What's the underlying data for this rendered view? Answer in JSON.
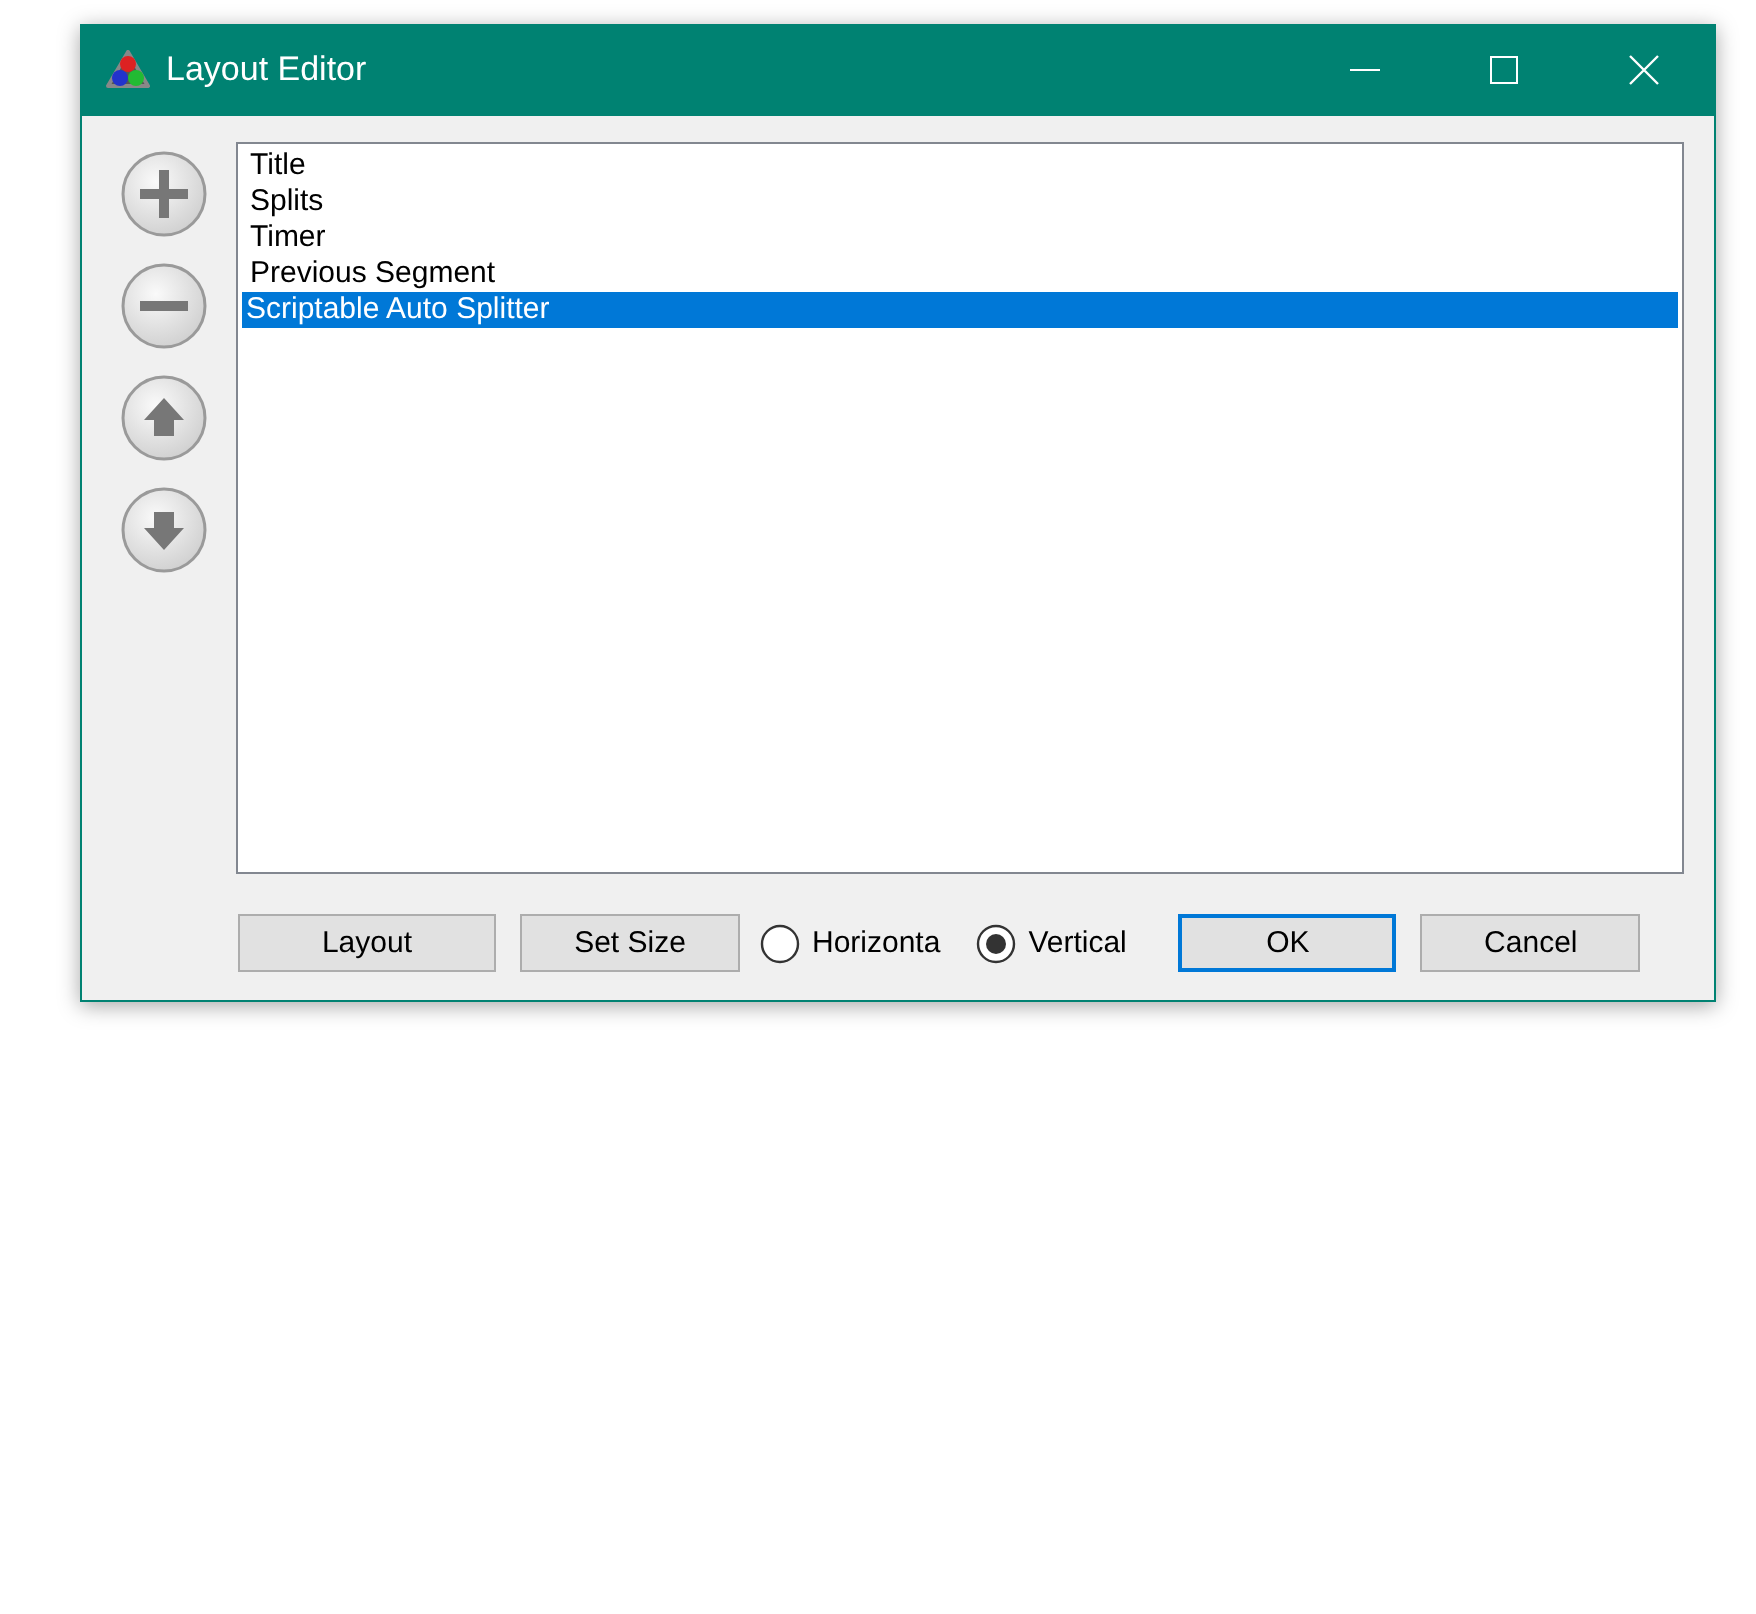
{
  "window": {
    "title": "Layout Editor"
  },
  "tools": [
    {
      "kind": "add"
    },
    {
      "kind": "remove"
    },
    {
      "kind": "up"
    },
    {
      "kind": "down"
    }
  ],
  "components": [
    {
      "label": "Title",
      "selected": false
    },
    {
      "label": "Splits",
      "selected": false
    },
    {
      "label": "Timer",
      "selected": false
    },
    {
      "label": "Previous Segment",
      "selected": false
    },
    {
      "label": "Scriptable Auto Splitter",
      "selected": true
    }
  ],
  "buttons_left": [
    {
      "label": "Layout"
    },
    {
      "label": "Set Size"
    }
  ],
  "orientation": [
    {
      "label": "Horizonta",
      "selected": false
    },
    {
      "label": "Vertical",
      "selected": true
    }
  ],
  "buttons_right": [
    {
      "label": "OK",
      "default": true
    },
    {
      "label": "Cancel",
      "default": false
    }
  ]
}
